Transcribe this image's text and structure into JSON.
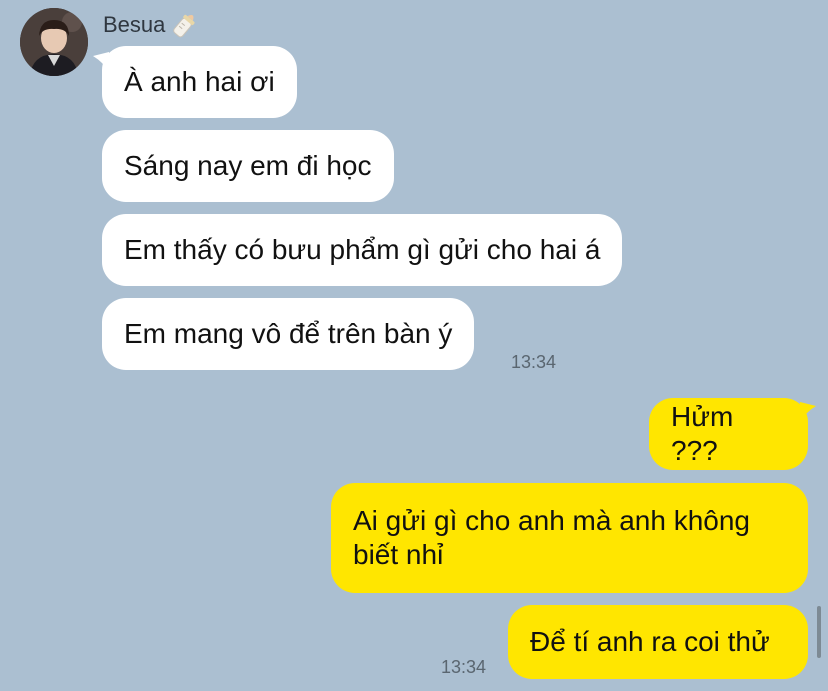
{
  "contact": {
    "name": "Besua",
    "name_icon": "baby-bottle-icon"
  },
  "incoming": [
    {
      "text": "À anh hai ơi"
    },
    {
      "text": "Sáng nay em đi học"
    },
    {
      "text": "Em thấy có bưu phẩm gì gửi cho hai á"
    },
    {
      "text": "Em mang vô để trên bàn ý"
    }
  ],
  "incoming_time": "13:34",
  "outgoing": [
    {
      "text": "Hửm ???"
    },
    {
      "text": "Ai gửi gì cho anh mà anh không biết nhỉ"
    },
    {
      "text": "Để tí anh ra coi thử"
    }
  ],
  "outgoing_time": "13:34",
  "colors": {
    "background": "#abbfd1",
    "incoming_bubble": "#ffffff",
    "outgoing_bubble": "#ffe600"
  }
}
